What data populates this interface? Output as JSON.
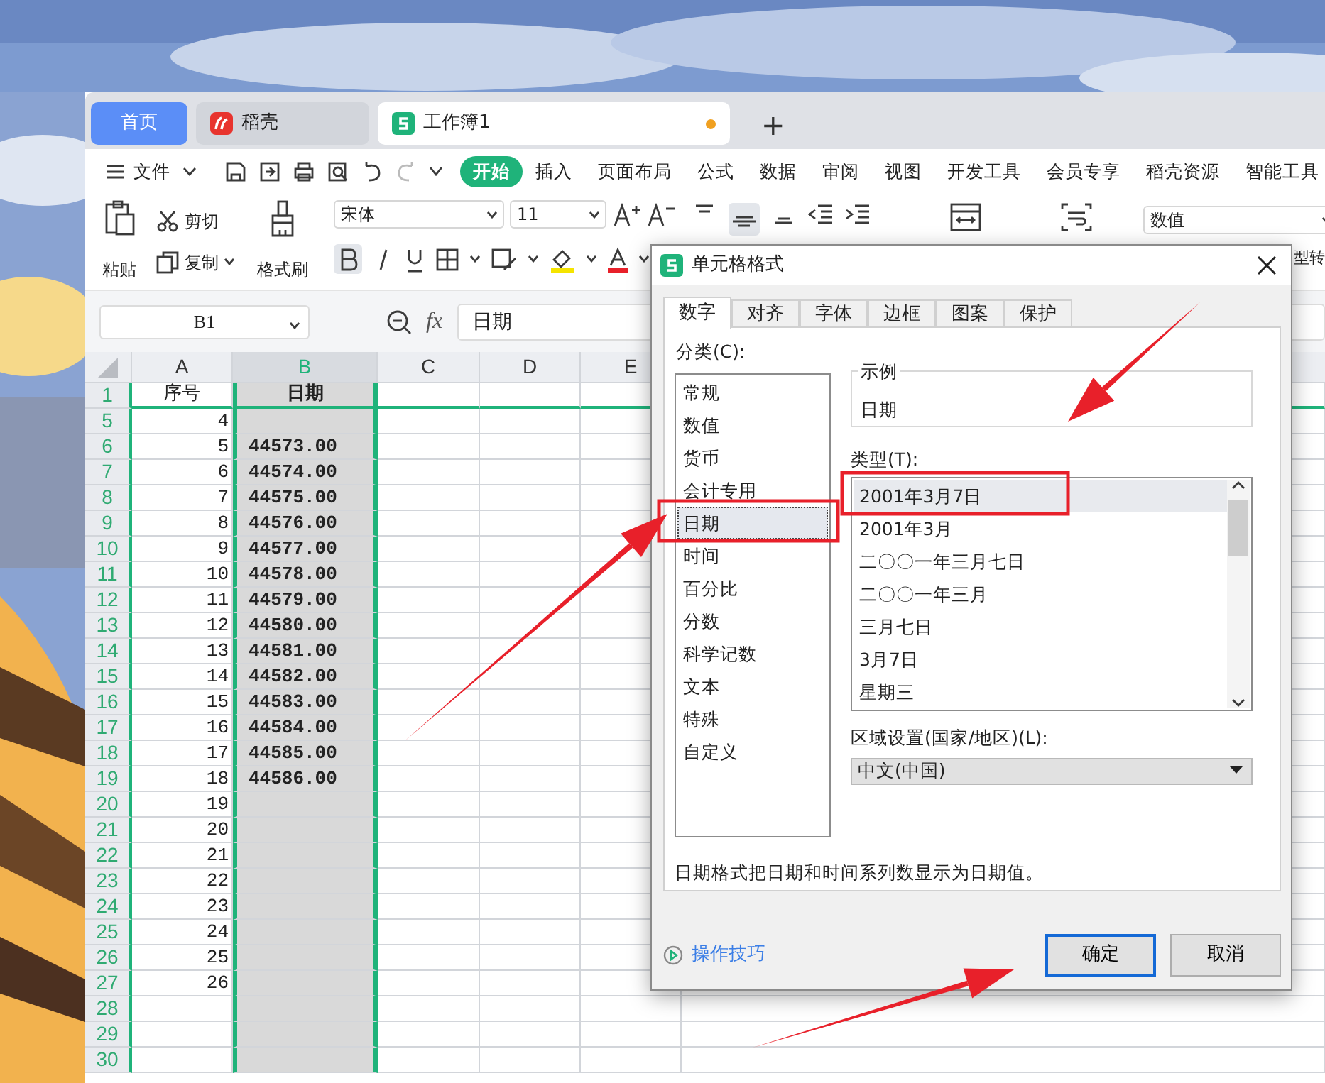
{
  "tabs": [
    {
      "label": "首页",
      "kind": "home",
      "selected": false
    },
    {
      "label": "稻壳",
      "kind": "docer",
      "selected": false
    },
    {
      "label": "工作簿1",
      "kind": "sheet",
      "selected": true,
      "unsaved": true
    }
  ],
  "new_tab": "+",
  "file_menu": "文件",
  "ribbon_tabs": [
    {
      "label": "开始",
      "selected": true
    },
    {
      "label": "插入",
      "selected": false
    },
    {
      "label": "页面布局",
      "selected": false
    },
    {
      "label": "公式",
      "selected": false
    },
    {
      "label": "数据",
      "selected": false
    },
    {
      "label": "审阅",
      "selected": false
    },
    {
      "label": "视图",
      "selected": false
    },
    {
      "label": "开发工具",
      "selected": false
    },
    {
      "label": "会员专享",
      "selected": false
    },
    {
      "label": "稻壳资源",
      "selected": false
    },
    {
      "label": "智能工具",
      "selected": false
    }
  ],
  "ribbon": {
    "paste": "粘贴",
    "cut": "剪切",
    "copy": "复制",
    "format_painter": "格式刷",
    "font": "宋体",
    "font_size": "11",
    "number_format": "数值",
    "cut_off_label": "型转"
  },
  "formula_bar": {
    "cell": "B1",
    "fx": "fx",
    "value": "日期"
  },
  "sheet": {
    "columns": [
      {
        "label": "A",
        "selected": false
      },
      {
        "label": "B",
        "selected": true
      },
      {
        "label": "C",
        "selected": false
      },
      {
        "label": "D",
        "selected": false
      },
      {
        "label": "E",
        "selected": false
      }
    ],
    "rows": [
      {
        "number": "1",
        "kind": "title",
        "a": "序号",
        "b": "日期"
      },
      {
        "number": "5",
        "a": "4"
      },
      {
        "number": "6",
        "a": "5",
        "b": "44573.00"
      },
      {
        "number": "7",
        "a": "6",
        "b": "44574.00"
      },
      {
        "number": "8",
        "a": "7",
        "b": "44575.00"
      },
      {
        "number": "9",
        "a": "8",
        "b": "44576.00"
      },
      {
        "number": "10",
        "a": "9",
        "b": "44577.00"
      },
      {
        "number": "11",
        "a": "10",
        "b": "44578.00"
      },
      {
        "number": "12",
        "a": "11",
        "b": "44579.00"
      },
      {
        "number": "13",
        "a": "12",
        "b": "44580.00"
      },
      {
        "number": "14",
        "a": "13",
        "b": "44581.00"
      },
      {
        "number": "15",
        "a": "14",
        "b": "44582.00"
      },
      {
        "number": "16",
        "a": "15",
        "b": "44583.00"
      },
      {
        "number": "17",
        "a": "16",
        "b": "44584.00"
      },
      {
        "number": "18",
        "a": "17",
        "b": "44585.00"
      },
      {
        "number": "19",
        "a": "18",
        "b": "44586.00"
      },
      {
        "number": "20",
        "a": "19"
      },
      {
        "number": "21",
        "a": "20"
      },
      {
        "number": "22",
        "a": "21"
      },
      {
        "number": "23",
        "a": "22"
      },
      {
        "number": "24",
        "a": "23"
      },
      {
        "number": "25",
        "a": "24"
      },
      {
        "number": "26",
        "a": "25"
      },
      {
        "number": "27",
        "a": "26"
      },
      {
        "number": "28"
      },
      {
        "number": "29"
      },
      {
        "number": "30"
      }
    ]
  },
  "dialog": {
    "title": "单元格格式",
    "tabs": [
      {
        "label": "数字",
        "selected": true
      },
      {
        "label": "对齐",
        "selected": false
      },
      {
        "label": "字体",
        "selected": false
      },
      {
        "label": "边框",
        "selected": false
      },
      {
        "label": "图案",
        "selected": false
      },
      {
        "label": "保护",
        "selected": false
      }
    ],
    "category_label": "分类(C):",
    "categories": [
      {
        "label": "常规",
        "selected": false
      },
      {
        "label": "数值",
        "selected": false
      },
      {
        "label": "货币",
        "selected": false
      },
      {
        "label": "会计专用",
        "selected": false
      },
      {
        "label": "日期",
        "selected": true
      },
      {
        "label": "时间",
        "selected": false
      },
      {
        "label": "百分比",
        "selected": false
      },
      {
        "label": "分数",
        "selected": false
      },
      {
        "label": "科学记数",
        "selected": false
      },
      {
        "label": "文本",
        "selected": false
      },
      {
        "label": "特殊",
        "selected": false
      },
      {
        "label": "自定义",
        "selected": false
      }
    ],
    "sample_label": "示例",
    "sample": "日期",
    "type_label": "类型(T):",
    "types": [
      {
        "label": "2001年3月7日",
        "selected": true
      },
      {
        "label": "2001年3月",
        "selected": false
      },
      {
        "label": "二〇〇一年三月七日",
        "selected": false
      },
      {
        "label": "二〇〇一年三月",
        "selected": false
      },
      {
        "label": "三月七日",
        "selected": false
      },
      {
        "label": "3月7日",
        "selected": false
      },
      {
        "label": "星期三",
        "selected": false
      }
    ],
    "locale_label": "区域设置(国家/地区)(L):",
    "locale": "中文(中国)",
    "description": "日期格式把日期和时间系列数显示为日期值。",
    "tips": "操作技巧",
    "ok": "确定",
    "cancel": "取消"
  }
}
